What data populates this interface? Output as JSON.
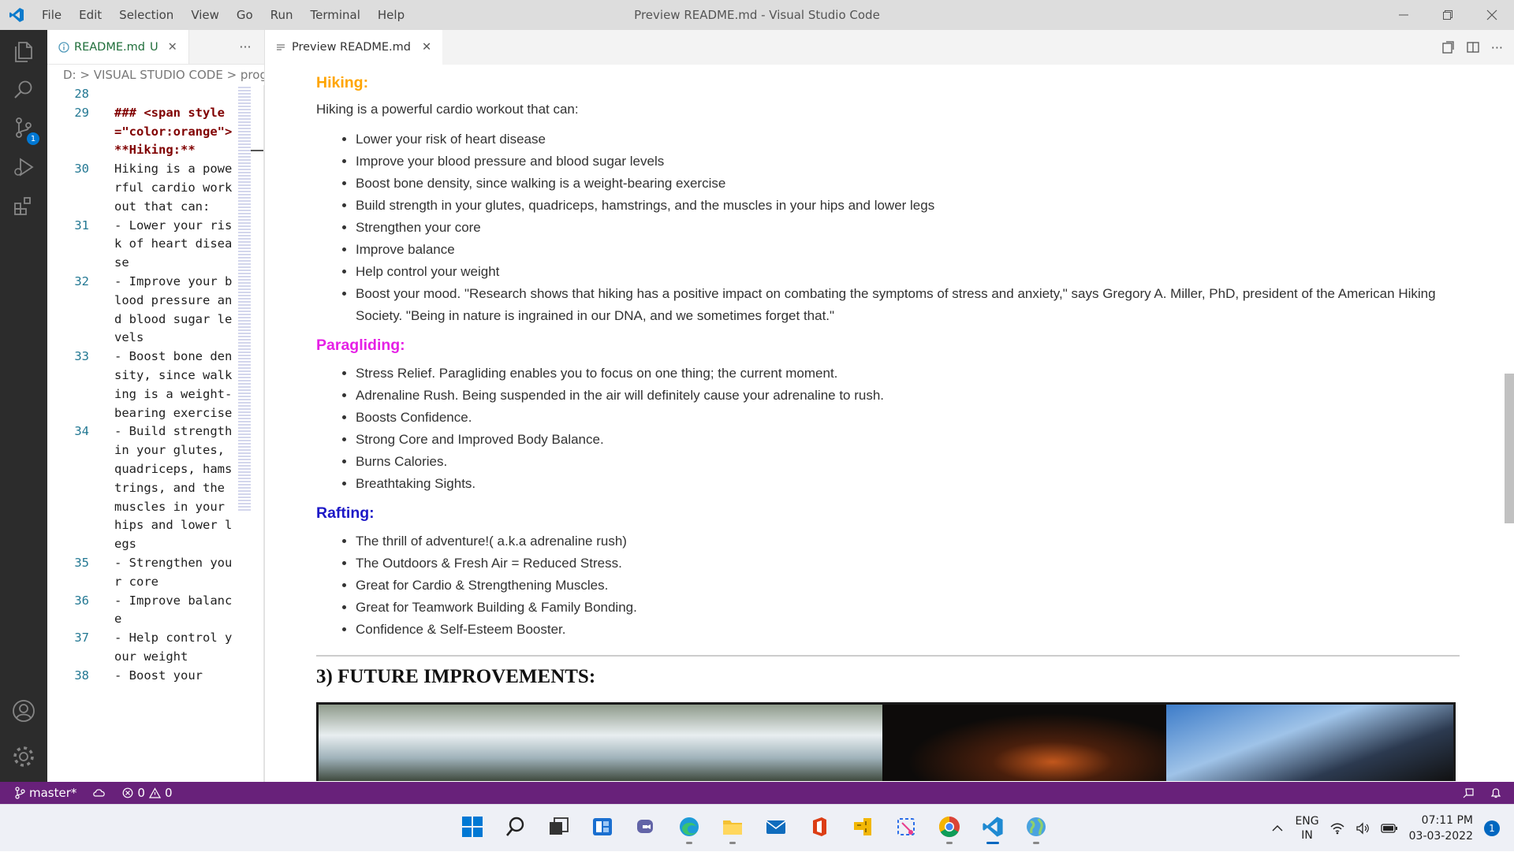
{
  "titlebar": {
    "menu": [
      "File",
      "Edit",
      "Selection",
      "View",
      "Go",
      "Run",
      "Terminal",
      "Help"
    ],
    "title": "Preview README.md - Visual Studio Code"
  },
  "activitybar": {
    "scm_badge": "1"
  },
  "editor": {
    "tab_label": "README.md",
    "tab_status": "U",
    "breadcrumb": "D: > VISUAL STUDIO CODE > progr",
    "lines": [
      {
        "n": "28",
        "text": "",
        "hdr": false
      },
      {
        "n": "29",
        "text": "### <span style=\"color:orange\">**Hiking:**",
        "hdr": true
      },
      {
        "n": "30",
        "text": "Hiking is a powerful cardio workout that can:",
        "hdr": false
      },
      {
        "n": "31",
        "text": "- Lower your risk of heart disease",
        "hdr": false
      },
      {
        "n": "32",
        "text": "- Improve your blood pressure and blood sugar levels",
        "hdr": false
      },
      {
        "n": "33",
        "text": "- Boost bone density, since walking is a weight-bearing exercise",
        "hdr": false
      },
      {
        "n": "34",
        "text": "- Build strength in your glutes, quadriceps, hamstrings, and the muscles in your hips and lower legs",
        "hdr": false
      },
      {
        "n": "35",
        "text": "- Strengthen your core",
        "hdr": false
      },
      {
        "n": "36",
        "text": "- Improve balance",
        "hdr": false
      },
      {
        "n": "37",
        "text": "- Help control your weight",
        "hdr": false
      },
      {
        "n": "38",
        "text": "- Boost your",
        "hdr": false
      }
    ]
  },
  "preview": {
    "tab_label": "Preview README.md",
    "hiking": {
      "heading": "Hiking:",
      "intro": "Hiking is a powerful cardio workout that can:",
      "items": [
        "Lower your risk of heart disease",
        "Improve your blood pressure and blood sugar levels",
        "Boost bone density, since walking is a weight-bearing exercise",
        "Build strength in your glutes, quadriceps, hamstrings, and the muscles in your hips and lower legs",
        "Strengthen your core",
        "Improve balance",
        "Help control your weight",
        "Boost your mood. \"Research shows that hiking has a positive impact on combating the symptoms of stress and anxiety,\" says Gregory A. Miller, PhD, president of the American Hiking Society. \"Being in nature is ingrained in our DNA, and we sometimes forget that.\""
      ]
    },
    "paragliding": {
      "heading": "Paragliding:",
      "items": [
        "Stress Relief. Paragliding enables you to focus on one thing; the current moment.",
        "Adrenaline Rush. Being suspended in the air will definitely cause your adrenaline to rush.",
        "Boosts Confidence.",
        "Strong Core and Improved Body Balance.",
        "Burns Calories.",
        "Breathtaking Sights."
      ]
    },
    "rafting": {
      "heading": "Rafting:",
      "items": [
        "The thrill of adventure!( a.k.a adrenaline rush)",
        "The Outdoors & Fresh Air = Reduced Stress.",
        "Great for Cardio & Strengthening Muscles.",
        "Great for Teamwork Building & Family Bonding.",
        "Confidence & Self-Esteem Booster."
      ]
    },
    "future_heading": "3) FUTURE IMPROVEMENTS:"
  },
  "statusbar": {
    "branch": "master*",
    "errors": "0",
    "warnings": "0"
  },
  "taskbar": {
    "lang_top": "ENG",
    "lang_bottom": "IN",
    "time": "07:11 PM",
    "date": "03-03-2022",
    "notifications": "1"
  },
  "colors": {
    "hiking": "#ffa500",
    "paragliding": "#e620e6",
    "rafting": "#1d18c7",
    "statusbar": "#68217a"
  }
}
